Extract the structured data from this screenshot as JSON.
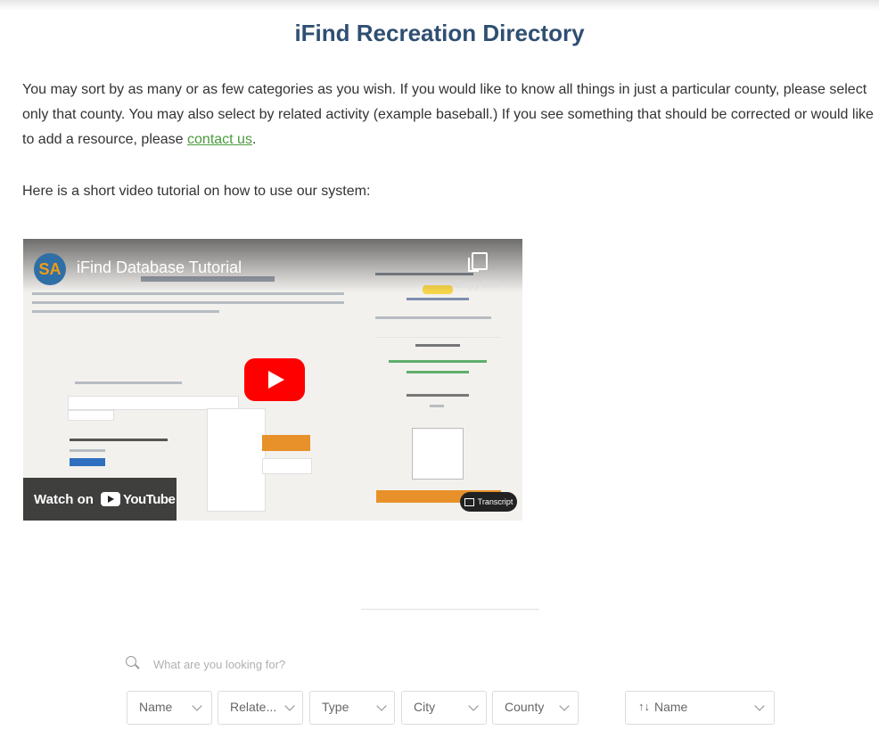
{
  "page_title": "iFind Recreation Directory",
  "intro": {
    "text": "You may sort by as many or as few categories as you wish. If you would like to know all things in just a particular county, please select only that county. You may also select by related activity (example baseball.) If you see something that should be corrected or would like to add a resource, please ",
    "link_label": "contact us",
    "end": "."
  },
  "tutorial_text": "Here is a short video tutorial on how to use our system:",
  "video": {
    "channel_logo": "SA",
    "title": "iFind Database Tutorial",
    "copy_link": "Copy link",
    "watch_on": "Watch on",
    "youtube": "YouTube",
    "cast_label": "Transcript",
    "icons": [
      "copy-icon",
      "play-icon",
      "youtube-icon"
    ]
  },
  "search": {
    "placeholder": "What are you looking for?"
  },
  "filters": [
    {
      "label": "Name"
    },
    {
      "label": "Relate..."
    },
    {
      "label": "Type"
    },
    {
      "label": "City"
    },
    {
      "label": "County"
    }
  ],
  "sort": {
    "icon": "↑↓",
    "label": "Name"
  },
  "colors": {
    "title": "#2f4f72",
    "link": "#4a9a3c",
    "play": "#ff0000"
  }
}
